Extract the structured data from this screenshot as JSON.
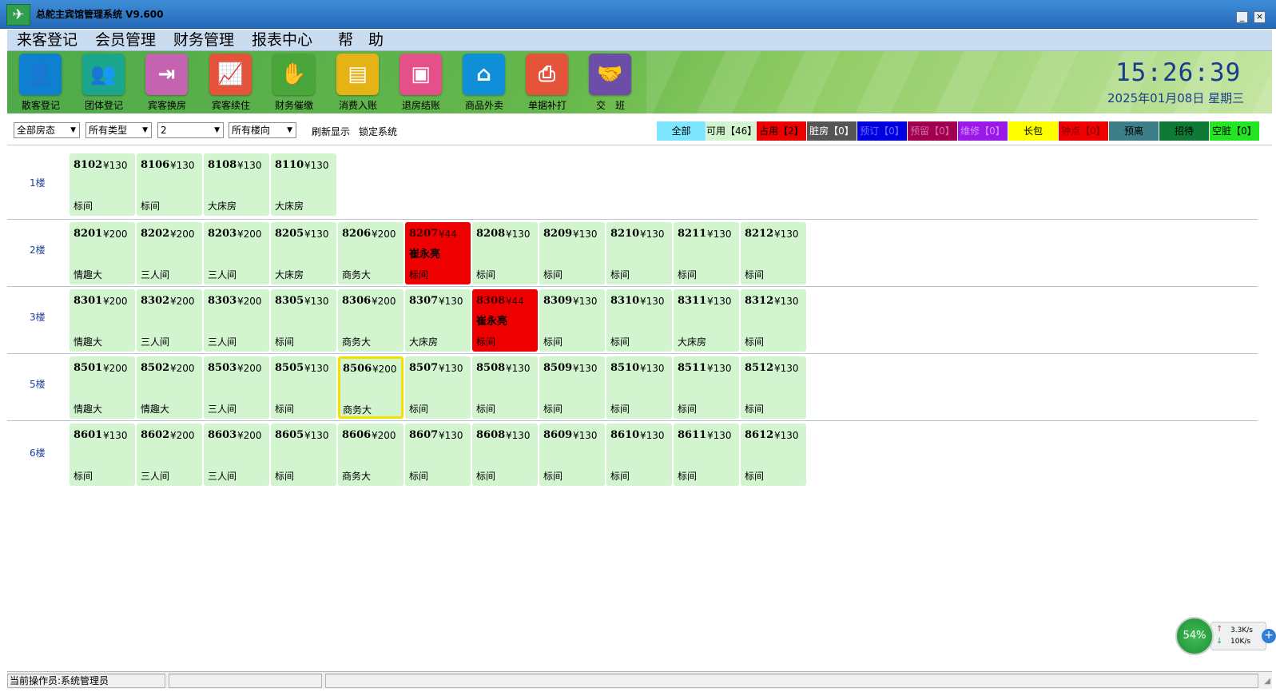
{
  "window": {
    "title": "总舵主宾馆管理系统 V9.600",
    "minimize_label": "_",
    "close_label": "×"
  },
  "menu": [
    "来客登记",
    "会员管理",
    "财务管理",
    "报表中心",
    "帮　助"
  ],
  "toolbar": [
    {
      "label": "散客登记",
      "icon": "person-icon",
      "color": "#0f7fd0",
      "glyph": "👤"
    },
    {
      "label": "团体登记",
      "icon": "group-icon",
      "color": "#1aa58c",
      "glyph": "👥"
    },
    {
      "label": "宾客换房",
      "icon": "door-icon",
      "color": "#c463b0",
      "glyph": "⇥"
    },
    {
      "label": "宾客续住",
      "icon": "chart-up-icon",
      "color": "#e5533a",
      "glyph": "📈"
    },
    {
      "label": "财务催缴",
      "icon": "hand-coin-icon",
      "color": "#4aa53a",
      "glyph": "✋"
    },
    {
      "label": "消费入账",
      "icon": "cash-register-icon",
      "color": "#e6b316",
      "glyph": "▤"
    },
    {
      "label": "退房结账",
      "icon": "wallet-icon",
      "color": "#e5508a",
      "glyph": "▣"
    },
    {
      "label": "商品外卖",
      "icon": "store-icon",
      "color": "#0f8fd8",
      "glyph": "⌂"
    },
    {
      "label": "单据补打",
      "icon": "printer-icon",
      "color": "#e5533a",
      "glyph": "⎙"
    },
    {
      "label": "交　班",
      "icon": "handshake-icon",
      "color": "#6c4ea8",
      "glyph": "🤝"
    }
  ],
  "clock": {
    "time": "15:26:39",
    "date": "2025年01月08日 星期三"
  },
  "filters": {
    "status": "全部房态",
    "type": "所有类型",
    "floor": "2",
    "direction": "所有楼向",
    "refresh_label": "刷新显示",
    "lock_label": "锁定系统"
  },
  "legend": [
    {
      "label": "全部",
      "bg": "#7fe6ff",
      "fg": "#000000"
    },
    {
      "label": "可用【46】",
      "bg": "#d2f5d0",
      "fg": "#000000"
    },
    {
      "label": "占用【2】",
      "bg": "#ef0000",
      "fg": "#000000"
    },
    {
      "label": "脏房【0】",
      "bg": "#555555",
      "fg": "#ffffff"
    },
    {
      "label": "预订【0】",
      "bg": "#0000e0",
      "fg": "#6a6aff"
    },
    {
      "label": "预留【0】",
      "bg": "#a0004f",
      "fg": "#d070a0"
    },
    {
      "label": "维修【0】",
      "bg": "#9b19e6",
      "fg": "#d090ff"
    },
    {
      "label": "长包",
      "bg": "#ffff00",
      "fg": "#000000"
    },
    {
      "label": "钟点【0】",
      "bg": "#ee0000",
      "fg": "#800000"
    },
    {
      "label": "预离",
      "bg": "#3d7f88",
      "fg": "#000000"
    },
    {
      "label": "招待",
      "bg": "#0f7a35",
      "fg": "#000000"
    },
    {
      "label": "空脏【0】",
      "bg": "#22e622",
      "fg": "#000000"
    }
  ],
  "floors": [
    {
      "label": "1楼",
      "rooms": [
        {
          "num": "8102",
          "price": "¥130",
          "type": "标间"
        },
        {
          "num": "8106",
          "price": "¥130",
          "type": "标间"
        },
        {
          "num": "8108",
          "price": "¥130",
          "type": "大床房"
        },
        {
          "num": "8110",
          "price": "¥130",
          "type": "大床房"
        }
      ]
    },
    {
      "label": "2楼",
      "rooms": [
        {
          "num": "8201",
          "price": "¥200",
          "type": "情趣大"
        },
        {
          "num": "8202",
          "price": "¥200",
          "type": "三人间"
        },
        {
          "num": "8203",
          "price": "¥200",
          "type": "三人间"
        },
        {
          "num": "8205",
          "price": "¥130",
          "type": "大床房"
        },
        {
          "num": "8206",
          "price": "¥200",
          "type": "商务大"
        },
        {
          "num": "8207",
          "price": "¥44",
          "type": "标间",
          "guest": "崔永亮",
          "status": "occupied"
        },
        {
          "num": "8208",
          "price": "¥130",
          "type": "标间"
        },
        {
          "num": "8209",
          "price": "¥130",
          "type": "标间"
        },
        {
          "num": "8210",
          "price": "¥130",
          "type": "标间"
        },
        {
          "num": "8211",
          "price": "¥130",
          "type": "标间"
        },
        {
          "num": "8212",
          "price": "¥130",
          "type": "标间"
        }
      ]
    },
    {
      "label": "3楼",
      "rooms": [
        {
          "num": "8301",
          "price": "¥200",
          "type": "情趣大"
        },
        {
          "num": "8302",
          "price": "¥200",
          "type": "三人间"
        },
        {
          "num": "8303",
          "price": "¥200",
          "type": "三人间"
        },
        {
          "num": "8305",
          "price": "¥130",
          "type": "标间"
        },
        {
          "num": "8306",
          "price": "¥200",
          "type": "商务大"
        },
        {
          "num": "8307",
          "price": "¥130",
          "type": "大床房"
        },
        {
          "num": "8308",
          "price": "¥44",
          "type": "标间",
          "guest": "崔永亮",
          "status": "occupied"
        },
        {
          "num": "8309",
          "price": "¥130",
          "type": "标间"
        },
        {
          "num": "8310",
          "price": "¥130",
          "type": "标间"
        },
        {
          "num": "8311",
          "price": "¥130",
          "type": "大床房"
        },
        {
          "num": "8312",
          "price": "¥130",
          "type": "标间"
        }
      ]
    },
    {
      "label": "5楼",
      "rooms": [
        {
          "num": "8501",
          "price": "¥200",
          "type": "情趣大"
        },
        {
          "num": "8502",
          "price": "¥200",
          "type": "情趣大"
        },
        {
          "num": "8503",
          "price": "¥200",
          "type": "三人间"
        },
        {
          "num": "8505",
          "price": "¥130",
          "type": "标间"
        },
        {
          "num": "8506",
          "price": "¥200",
          "type": "商务大",
          "status": "selected"
        },
        {
          "num": "8507",
          "price": "¥130",
          "type": "标间"
        },
        {
          "num": "8508",
          "price": "¥130",
          "type": "标间"
        },
        {
          "num": "8509",
          "price": "¥130",
          "type": "标间"
        },
        {
          "num": "8510",
          "price": "¥130",
          "type": "标间"
        },
        {
          "num": "8511",
          "price": "¥130",
          "type": "标间"
        },
        {
          "num": "8512",
          "price": "¥130",
          "type": "标间"
        }
      ]
    },
    {
      "label": "6楼",
      "rooms": [
        {
          "num": "8601",
          "price": "¥130",
          "type": "标间"
        },
        {
          "num": "8602",
          "price": "¥200",
          "type": "三人间"
        },
        {
          "num": "8603",
          "price": "¥200",
          "type": "三人间"
        },
        {
          "num": "8605",
          "price": "¥130",
          "type": "标间"
        },
        {
          "num": "8606",
          "price": "¥200",
          "type": "商务大"
        },
        {
          "num": "8607",
          "price": "¥130",
          "type": "标间"
        },
        {
          "num": "8608",
          "price": "¥130",
          "type": "标间"
        },
        {
          "num": "8609",
          "price": "¥130",
          "type": "标间"
        },
        {
          "num": "8610",
          "price": "¥130",
          "type": "标间"
        },
        {
          "num": "8611",
          "price": "¥130",
          "type": "标间"
        },
        {
          "num": "8612",
          "price": "¥130",
          "type": "标间"
        }
      ]
    }
  ],
  "network": {
    "percent": "54%",
    "up": "3.3K/s",
    "down": "10K/s",
    "up_arrow": "↑",
    "down_arrow": "↓",
    "plus": "+"
  },
  "status": {
    "operator": "当前操作员:系统管理员",
    "cell2": "",
    "cell3": ""
  }
}
